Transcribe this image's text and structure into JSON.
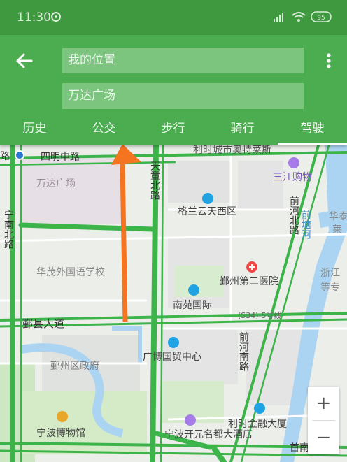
{
  "status_bar": {
    "time": "11:30",
    "battery": "95"
  },
  "search": {
    "origin": "我的位置",
    "destination": "万达广场"
  },
  "tabs": [
    "历史",
    "公交",
    "步行",
    "骑行",
    "驾驶"
  ],
  "active_tab": "驾驶",
  "map": {
    "roads": [
      "四明中路",
      "宁南北路",
      "天童北路",
      "鄞县大道",
      "前河北路",
      "前河南路",
      "前塘河"
    ],
    "places": [
      "万达广场",
      "华茂外国语学校",
      "利时城市奥特莱斯",
      "格兰云天西区",
      "三江购物",
      "鄞州第二医院",
      "南苑国际",
      "鄞州区政府",
      "广博国贸中心",
      "宁波博物馆",
      "宁波开元名都大酒店",
      "利时金融大厦",
      "浙江",
      "等专",
      "华泰",
      "莱",
      "首南"
    ],
    "labels_partial": [
      "路",
      "(S34)-5号线"
    ]
  },
  "zoom": {
    "in": "+",
    "out": "−"
  },
  "colors": {
    "primary": "#4bad4f",
    "route_arrow": "#f4741f",
    "road_green": "#3cb44a"
  }
}
